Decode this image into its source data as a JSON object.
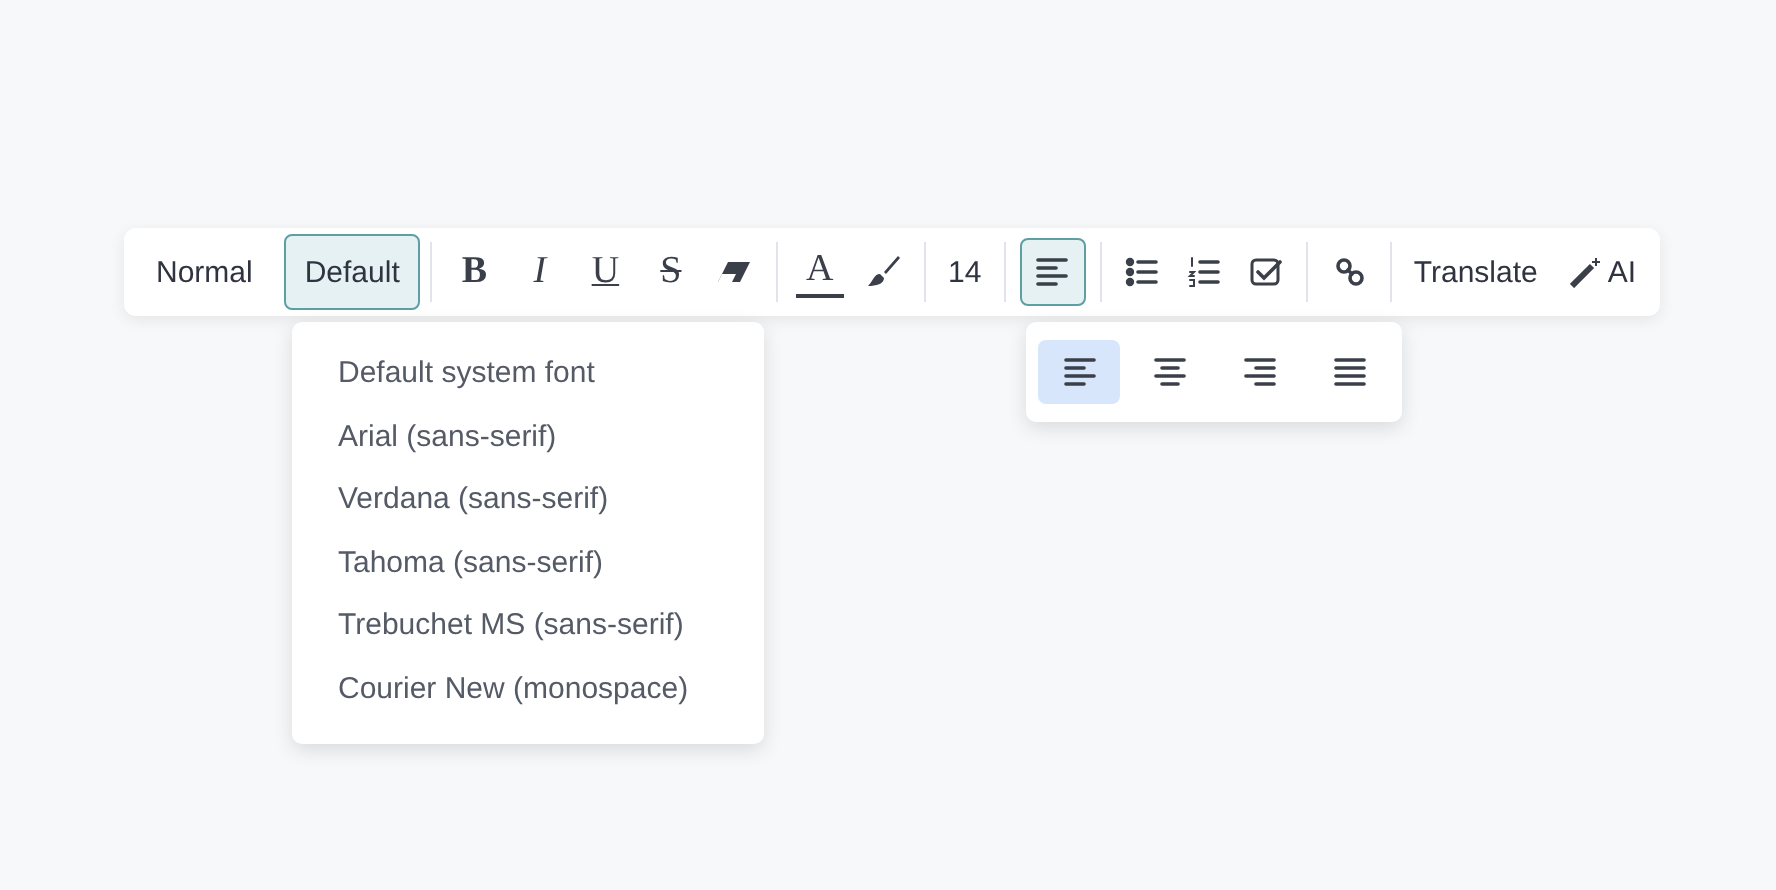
{
  "toolbar": {
    "block_style": {
      "label": "Normal",
      "selected": false
    },
    "font": {
      "label": "Default",
      "selected": true
    },
    "format_buttons": [
      {
        "label": "B",
        "kind": "bold"
      },
      {
        "label": "I",
        "kind": "italic"
      },
      {
        "label": "U",
        "kind": "underline"
      },
      {
        "label": "S",
        "kind": "strike"
      }
    ],
    "text_color": {
      "label": "A"
    },
    "font_size": "14",
    "align_button": {
      "selected": true
    },
    "translate": "Translate",
    "ai": "AI"
  },
  "font_menu": [
    {
      "label": "Default system font"
    },
    {
      "label": "Arial (sans-serif)"
    },
    {
      "label": "Verdana (sans-serif)"
    },
    {
      "label": "Tahoma (sans-serif)"
    },
    {
      "label": "Trebuchet MS (sans-serif)"
    },
    {
      "label": "Courier New (monospace)"
    }
  ],
  "align_menu": [
    {
      "kind": "left",
      "selected": true
    },
    {
      "kind": "center",
      "selected": false
    },
    {
      "kind": "right",
      "selected": false
    },
    {
      "kind": "justify",
      "selected": false
    }
  ]
}
